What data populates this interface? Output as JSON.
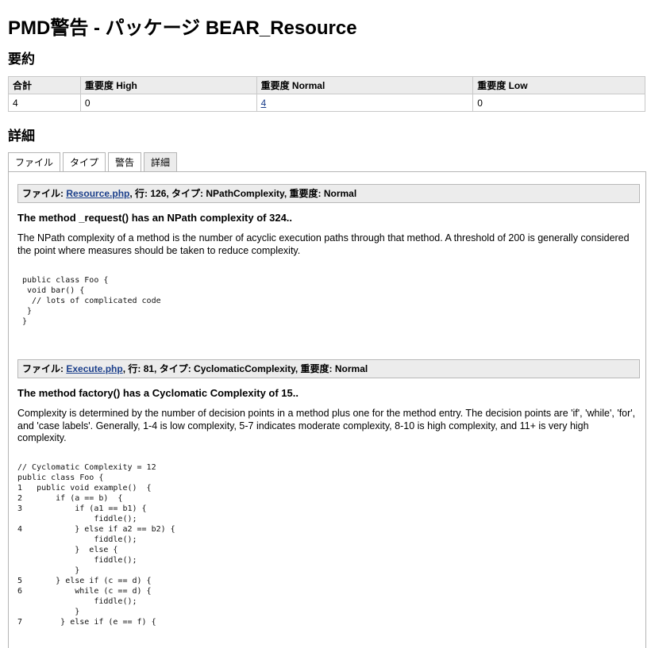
{
  "page_title": "PMD警告 - パッケージ BEAR_Resource",
  "summary": {
    "heading": "要約",
    "headers": [
      "合計",
      "重要度 High",
      "重要度 Normal",
      "重要度 Low"
    ],
    "values": [
      "4",
      "0",
      "4",
      "0"
    ]
  },
  "details": {
    "heading": "詳細",
    "tabs": [
      "ファイル",
      "タイプ",
      "警告",
      "詳細"
    ],
    "active_tab": "詳細"
  },
  "violations": [
    {
      "file_label": "ファイル: ",
      "file_link": "Resource.php",
      "meta": ", 行: 126, タイプ: NPathComplexity, 重要度: Normal",
      "message": "The method _request() has an NPath complexity of 324..",
      "description": "The NPath complexity of a method is the number of acyclic execution paths through that method. A threshold of 200 is generally considered the point where measures should be taken to reduce complexity.",
      "example": " public class Foo {\n  void bar() {\n   // lots of complicated code\n  }\n }"
    },
    {
      "file_label": "ファイル: ",
      "file_link": "Execute.php",
      "meta": ", 行: 81, タイプ: CyclomaticComplexity, 重要度: Normal",
      "message": "The method factory() has a Cyclomatic Complexity of 15..",
      "description": "Complexity is determined by the number of decision points in a method plus one for the method entry. The decision points are 'if', 'while', 'for', and 'case labels'. Generally, 1-4 is low complexity, 5-7 indicates moderate complexity, 8-10 is high complexity, and 11+ is very high complexity.",
      "example": "// Cyclomatic Complexity = 12\npublic class Foo {\n1   public void example()  {\n2       if (a == b)  {\n3           if (a1 == b1) {\n                fiddle();\n4           } else if a2 == b2) {\n                fiddle();\n            }  else {\n                fiddle();\n            }\n5       } else if (c == d) {\n6           while (c == d) {\n                fiddle();\n            }\n7        } else if (e == f) {"
    }
  ]
}
